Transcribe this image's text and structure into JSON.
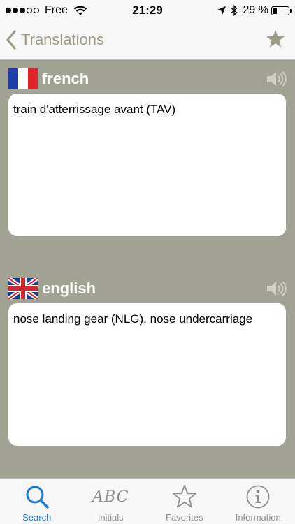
{
  "status_bar": {
    "carrier": "Free",
    "time": "21:29",
    "battery_text": "29 %",
    "battery_level": 0.29,
    "signal_full_dots": 3,
    "signal_total_dots": 5
  },
  "nav": {
    "back_label": "Translations",
    "back_icon": "chevron-left-icon",
    "favorite_icon": "star-icon",
    "accent_color": "#9e9a87"
  },
  "source": {
    "language": "french",
    "flag": "france-flag-icon",
    "text": "train d'atterrissage avant (TAV)"
  },
  "target": {
    "language": "english",
    "flag": "uk-flag-icon",
    "text": "nose landing gear (NLG), nose undercarriage"
  },
  "tabs": [
    {
      "label": "Search",
      "icon": "search-icon",
      "active": true
    },
    {
      "label": "Initials",
      "icon": "abc-icon",
      "icon_text": "ABC",
      "active": false
    },
    {
      "label": "Favorites",
      "icon": "star-outline-icon",
      "active": false
    },
    {
      "label": "Information",
      "icon": "info-icon",
      "active": false
    }
  ],
  "colors": {
    "background": "#a2a294",
    "active_tab": "#1a7ad9",
    "inactive_tab": "#8e8e8e"
  }
}
